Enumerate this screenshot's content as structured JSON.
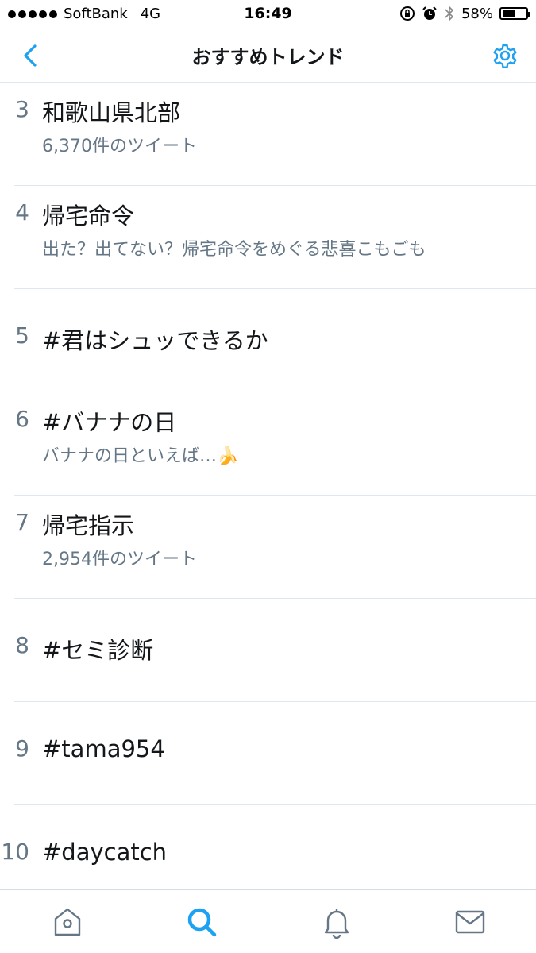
{
  "status_bar": {
    "carrier": "SoftBank",
    "network": "4G",
    "time": "16:49",
    "battery_percent": "58%",
    "battery_level": 0.58,
    "icons": [
      "orientation-lock-icon",
      "alarm-icon",
      "bluetooth-icon",
      "battery-icon"
    ]
  },
  "header": {
    "title": "おすすめトレンド",
    "back_icon": "chevron-left-icon",
    "settings_icon": "gear-icon",
    "accent_color": "#1da1f2"
  },
  "trends": [
    {
      "rank": "3",
      "name": "和歌山県北部",
      "subtitle": "6,370件のツイート"
    },
    {
      "rank": "4",
      "name": "帰宅命令",
      "subtitle": "出た？出てない？帰宅命令をめぐる悲喜こもごも"
    },
    {
      "rank": "5",
      "name": "#君はシュッできるか",
      "subtitle": ""
    },
    {
      "rank": "6",
      "name": "#バナナの日",
      "subtitle": "バナナの日といえば…🍌"
    },
    {
      "rank": "7",
      "name": "帰宅指示",
      "subtitle": "2,954件のツイート"
    },
    {
      "rank": "8",
      "name": "#セミ診断",
      "subtitle": ""
    },
    {
      "rank": "9",
      "name": "#tama954",
      "subtitle": ""
    },
    {
      "rank": "10",
      "name": "#daycatch",
      "subtitle": ""
    }
  ],
  "tab_bar": {
    "tabs": [
      {
        "icon": "home-icon",
        "active": false
      },
      {
        "icon": "search-icon",
        "active": true
      },
      {
        "icon": "bell-icon",
        "active": false
      },
      {
        "icon": "mail-icon",
        "active": false
      }
    ],
    "active_color": "#1da1f2",
    "inactive_color": "#657786"
  }
}
